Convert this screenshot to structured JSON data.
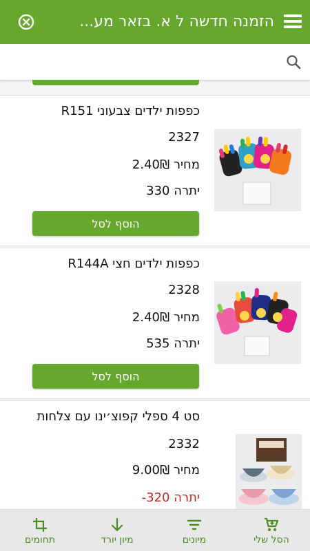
{
  "header": {
    "title": "הזמנה חדשה ל א. בזאר מע...",
    "menu_icon": "hamburger-menu-icon",
    "close_icon": "close-circle-icon"
  },
  "search": {
    "placeholder": "",
    "value": "",
    "icon": "search-icon"
  },
  "products": [
    {
      "name": "כפפות ילדים צבעוני R151",
      "code": "2327",
      "price": "מחיר 2.40₪",
      "stock": "יתרה 330",
      "stock_negative": false,
      "add_label": "הוסף לסל"
    },
    {
      "name": "כפפות ילדים חצי R144A",
      "code": "2328",
      "price": "מחיר 2.40₪",
      "stock": "יתרה 535",
      "stock_negative": false,
      "add_label": "הוסף לסל"
    },
    {
      "name": "סט 4 ספלי קפוצ׳ינו עם צלחות",
      "code": "2332",
      "price": "מחיר 9.00₪",
      "stock": "יתרה 320-",
      "stock_negative": true
    }
  ],
  "bottom_nav": [
    {
      "label": "הסל שלי",
      "icon": "cart-icon"
    },
    {
      "label": "מיונים",
      "icon": "filter-icon"
    },
    {
      "label": "מיון יורד",
      "icon": "arrow-down-icon"
    },
    {
      "label": "תחומים",
      "icon": "crop-icon"
    }
  ],
  "colors": {
    "accent": "#66a82e",
    "negative_stock": "#c62828"
  }
}
